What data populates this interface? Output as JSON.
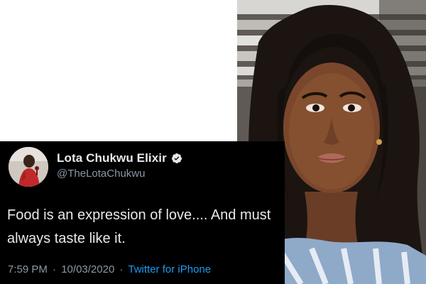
{
  "tweet": {
    "display_name": "Lota Chukwu Elixir",
    "handle": "@TheLotaChukwu",
    "text": "Food is an expression of love.... And must always taste like it.",
    "time": "7:59 PM",
    "separator": "·",
    "date": "10/03/2020",
    "source": "Twitter for iPhone",
    "verified": true,
    "icons": {
      "verified": "verified-badge-icon",
      "avatar": "profile-avatar"
    }
  },
  "photo": {
    "subject": "portrait-photo"
  },
  "colors": {
    "card_background": "#000000",
    "name_text": "#e7e9ea",
    "secondary_text": "#8b98a5",
    "link_blue": "#1d9bf0",
    "verified_blue": "#1d9bf0"
  }
}
